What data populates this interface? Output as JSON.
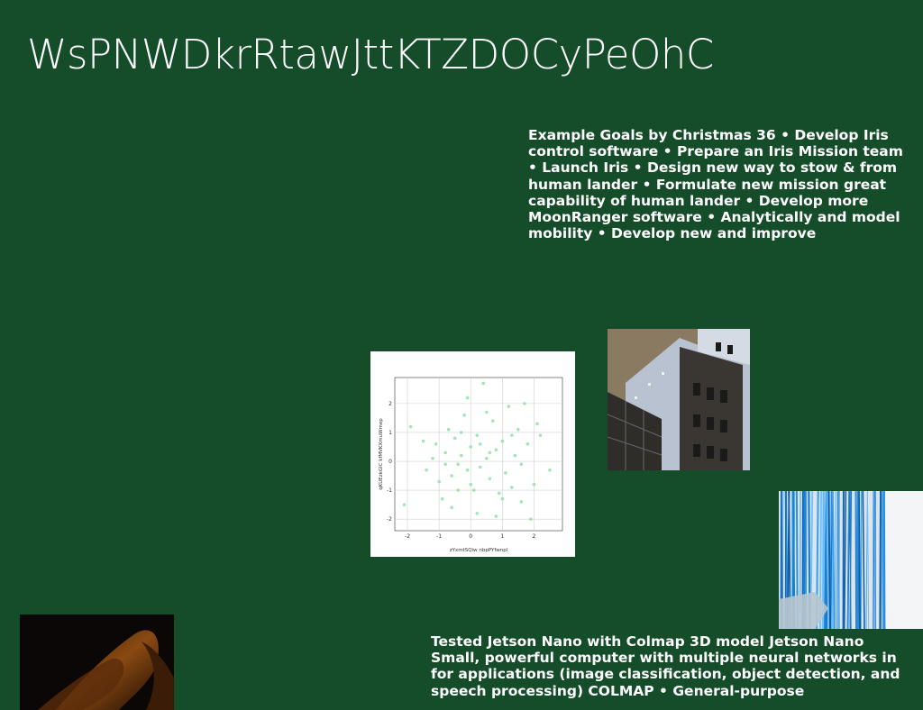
{
  "slide": {
    "title": "WsPNWDkrRtawJttKTZDOCyPeOhC",
    "goals_text": "Example Goals by Christmas 36 • Develop Iris control software • Prepare an Iris Mission team • Launch Iris • Design new way to stow & from human lander • Formulate new mission great capability of human lander • Develop more MoonRanger software • Analytically and model mobility • Develop new and improve",
    "jetson_text": "Tested Jetson Nano with Colmap 3D model Jetson Nano Small, powerful computer with multiple neural networks in for applications (image classification, object detection, and speech processing) COLMAP • General-purpose",
    "background_color": "#154c2a"
  },
  "chart_data": {
    "type": "scatter",
    "xlabel": "zYxmtSQiw nbpPYfwnpl",
    "ylabel": "qKUEzkGIC kfMVKXmuWmep",
    "xlim": [
      -2.4,
      2.9
    ],
    "ylim": [
      -2.4,
      2.9
    ],
    "xticks": [
      "-2",
      "-1",
      "0",
      "1",
      "2"
    ],
    "yticks": [
      "2",
      "1",
      "0",
      "-1",
      "-2"
    ],
    "grid": true,
    "marker_color": "#8fe3a3",
    "points": [
      [
        -1.9,
        1.2
      ],
      [
        -2.1,
        -1.5
      ],
      [
        -1.4,
        -0.3
      ],
      [
        -1.1,
        0.6
      ],
      [
        -1.0,
        -0.7
      ],
      [
        -0.8,
        0.3
      ],
      [
        -0.9,
        -1.3
      ],
      [
        -0.7,
        1.1
      ],
      [
        -0.6,
        -0.5
      ],
      [
        -0.5,
        0.8
      ],
      [
        -0.4,
        -0.1
      ],
      [
        -0.3,
        0.2
      ],
      [
        -0.2,
        1.6
      ],
      [
        -0.1,
        -0.3
      ],
      [
        0.0,
        0.5
      ],
      [
        0.1,
        -1.0
      ],
      [
        0.2,
        0.9
      ],
      [
        0.3,
        -0.2
      ],
      [
        0.4,
        2.7
      ],
      [
        0.5,
        0.1
      ],
      [
        0.6,
        -0.6
      ],
      [
        0.7,
        1.4
      ],
      [
        0.8,
        0.4
      ],
      [
        0.9,
        -1.1
      ],
      [
        1.0,
        0.7
      ],
      [
        1.1,
        -0.4
      ],
      [
        1.2,
        1.9
      ],
      [
        1.3,
        -0.9
      ],
      [
        1.4,
        0.2
      ],
      [
        1.5,
        1.1
      ],
      [
        1.6,
        -0.1
      ],
      [
        1.7,
        2.0
      ],
      [
        1.8,
        0.6
      ],
      [
        2.0,
        -0.8
      ],
      [
        2.2,
        0.9
      ],
      [
        2.5,
        -0.3
      ],
      [
        -1.2,
        0.1
      ],
      [
        -0.6,
        -1.6
      ],
      [
        0.2,
        -1.8
      ],
      [
        0.8,
        -1.9
      ],
      [
        1.9,
        -2.0
      ],
      [
        -0.3,
        1.0
      ],
      [
        0.5,
        1.7
      ],
      [
        1.0,
        -1.3
      ],
      [
        -1.5,
        0.7
      ],
      [
        0.0,
        -0.8
      ],
      [
        0.6,
        0.3
      ],
      [
        -0.8,
        -0.1
      ],
      [
        1.3,
        0.9
      ],
      [
        2.1,
        1.3
      ],
      [
        -0.1,
        2.2
      ],
      [
        0.3,
        0.6
      ],
      [
        -0.4,
        -1.0
      ],
      [
        1.6,
        -1.4
      ]
    ]
  }
}
